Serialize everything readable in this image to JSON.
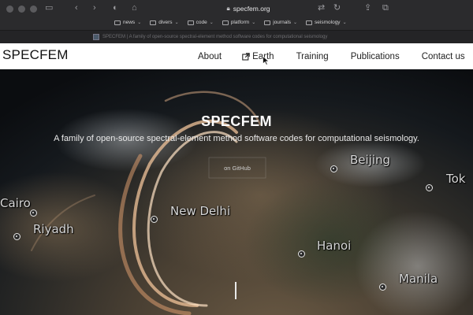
{
  "browser": {
    "url": "specfem.org",
    "bookmarks": [
      {
        "label": "news"
      },
      {
        "label": "divers"
      },
      {
        "label": "code"
      },
      {
        "label": "platform"
      },
      {
        "label": "journals"
      },
      {
        "label": "seismology"
      }
    ],
    "tab_title": "SPECFEM | A family of open-source spectral-element method software codes for computational seismology"
  },
  "site": {
    "brand": "SPECFEM",
    "nav": {
      "about": "About",
      "earth": "Earth",
      "training": "Training",
      "publications": "Publications",
      "contact": "Contact us"
    }
  },
  "hero": {
    "title": "SPECFEM",
    "subtitle": "A family of open-source spectral-element method software codes for computational seismology.",
    "github_button": "on GitHub",
    "cities": {
      "beijing": "Beijing",
      "tokyo": "Tok",
      "cairo": "Cairo",
      "riyadh": "Riyadh",
      "new_delhi": "New  Delhi",
      "hanoi": "Hanoi",
      "manila": "Manila"
    }
  }
}
